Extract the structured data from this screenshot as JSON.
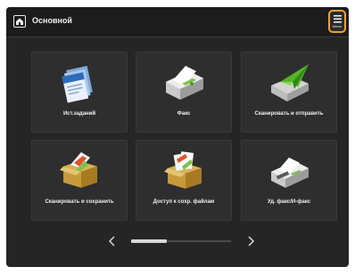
{
  "header": {
    "title": "Основной",
    "menu_label": "Меню"
  },
  "tiles": [
    {
      "label": "Ист.заданий",
      "icon": "history-icon"
    },
    {
      "label": "Факс",
      "icon": "fax-icon"
    },
    {
      "label": "Сканировать и отправить",
      "icon": "scan-send-icon"
    },
    {
      "label": "Сканировать и сохранить",
      "icon": "scan-store-icon"
    },
    {
      "label": "Доступ к сохр. файлам",
      "icon": "stored-files-icon"
    },
    {
      "label": "Уд. факс/И-факс",
      "icon": "remote-fax-icon"
    }
  ],
  "pager": {
    "page": 1,
    "pages": 3
  },
  "colors": {
    "background": "#252525",
    "tile": "#2e2e2e",
    "accent": "#f0a030"
  }
}
